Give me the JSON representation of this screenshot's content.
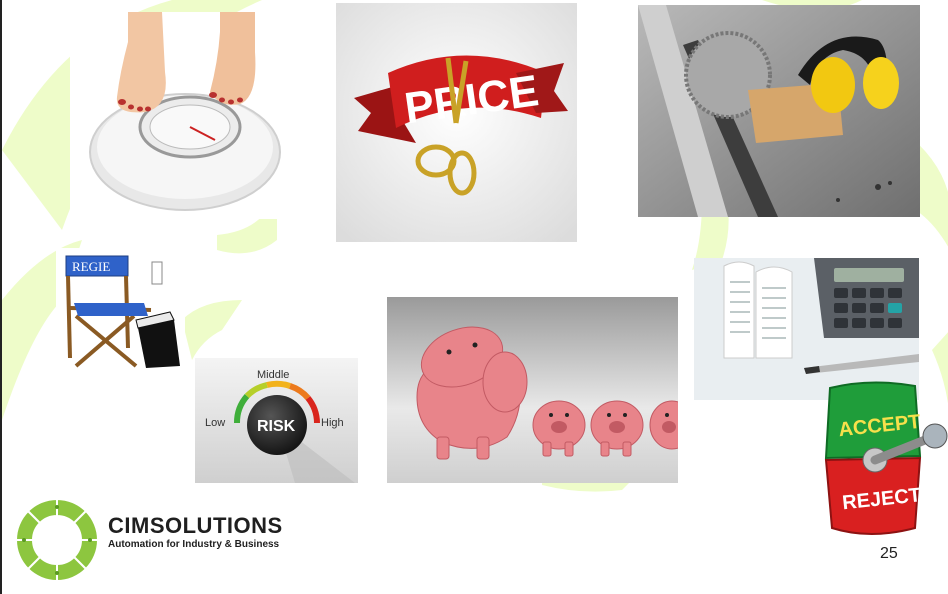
{
  "slide": {
    "page_number": "25",
    "accent_color": "#c7ef3b"
  },
  "images": {
    "scale": {
      "icon": "bathroom-scale"
    },
    "price": {
      "icon": "price-cut",
      "text": "PRICE"
    },
    "saw": {
      "icon": "table-saw-earmuffs"
    },
    "chair": {
      "icon": "director-chair",
      "text": "REGIE"
    },
    "risk": {
      "icon": "risk-dial",
      "low": "Low",
      "middle": "Middle",
      "high": "High",
      "center": "RISK"
    },
    "piggy": {
      "icon": "piggy-banks"
    },
    "calc": {
      "icon": "receipt-calculator"
    },
    "switch": {
      "icon": "accept-reject-switch",
      "accept": "ACCEPT",
      "reject": "REJECT"
    }
  },
  "logo": {
    "name": "CIMSOLUTIONS",
    "tagline": "Automation for Industry & Business"
  }
}
